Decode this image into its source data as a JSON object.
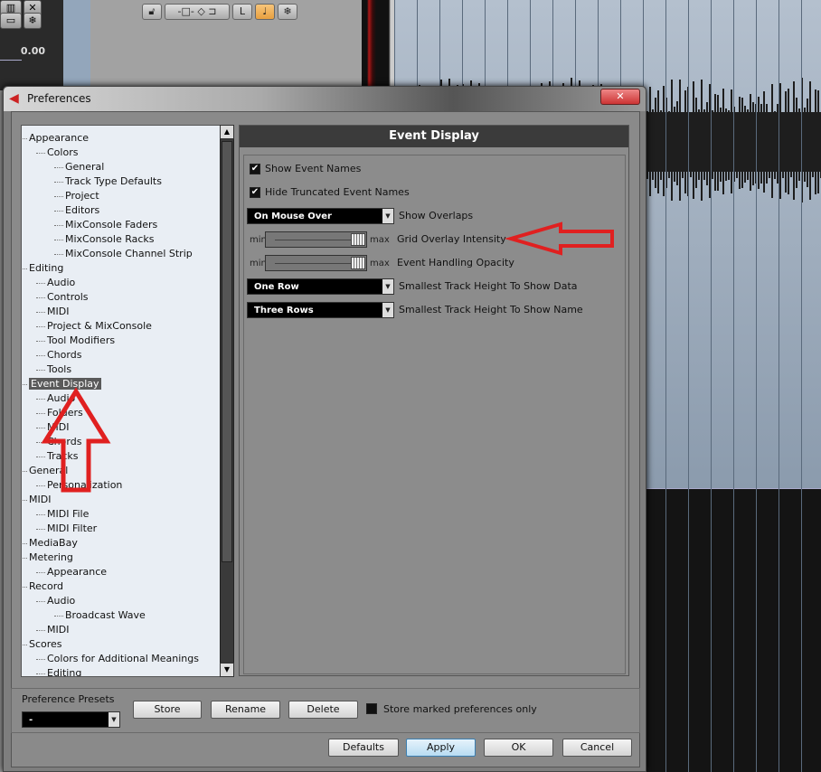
{
  "background": {
    "volume_readout": "0.00",
    "toolbar_icons": [
      "lock-icon",
      "snap-icon",
      "move-icon",
      "glue-icon",
      "corner-icon",
      "note-icon",
      "freeze-icon"
    ]
  },
  "dialog": {
    "title": "Preferences",
    "close_label": "✕",
    "tree": [
      {
        "label": "Appearance",
        "level": 0
      },
      {
        "label": "Colors",
        "level": 1
      },
      {
        "label": "General",
        "level": 2
      },
      {
        "label": "Track Type Defaults",
        "level": 2
      },
      {
        "label": "Project",
        "level": 2
      },
      {
        "label": "Editors",
        "level": 2
      },
      {
        "label": "MixConsole Faders",
        "level": 2
      },
      {
        "label": "MixConsole Racks",
        "level": 2
      },
      {
        "label": "MixConsole Channel Strip",
        "level": 2
      },
      {
        "label": "Editing",
        "level": 0
      },
      {
        "label": "Audio",
        "level": 1
      },
      {
        "label": "Controls",
        "level": 1
      },
      {
        "label": "MIDI",
        "level": 1
      },
      {
        "label": "Project & MixConsole",
        "level": 1
      },
      {
        "label": "Tool Modifiers",
        "level": 1
      },
      {
        "label": "Chords",
        "level": 1
      },
      {
        "label": "Tools",
        "level": 1
      },
      {
        "label": "Event Display",
        "level": 0,
        "selected": true
      },
      {
        "label": "Audio",
        "level": 1
      },
      {
        "label": "Folders",
        "level": 1
      },
      {
        "label": "MIDI",
        "level": 1
      },
      {
        "label": "Chords",
        "level": 1
      },
      {
        "label": "Tracks",
        "level": 1
      },
      {
        "label": "General",
        "level": 0
      },
      {
        "label": "Personalization",
        "level": 1
      },
      {
        "label": "MIDI",
        "level": 0
      },
      {
        "label": "MIDI File",
        "level": 1
      },
      {
        "label": "MIDI Filter",
        "level": 1
      },
      {
        "label": "MediaBay",
        "level": 0
      },
      {
        "label": "Metering",
        "level": 0
      },
      {
        "label": "Appearance",
        "level": 1
      },
      {
        "label": "Record",
        "level": 0
      },
      {
        "label": "Audio",
        "level": 1
      },
      {
        "label": "Broadcast Wave",
        "level": 2
      },
      {
        "label": "MIDI",
        "level": 1
      },
      {
        "label": "Scores",
        "level": 0
      },
      {
        "label": "Colors for Additional Meanings",
        "level": 1
      },
      {
        "label": "Editing",
        "level": 1
      }
    ],
    "panel": {
      "title": "Event Display",
      "show_event_names": {
        "label": "Show Event Names",
        "checked": true
      },
      "hide_truncated": {
        "label": "Hide Truncated Event Names",
        "checked": true
      },
      "show_overlaps": {
        "label": "Show Overlaps",
        "value": "On Mouse Over"
      },
      "grid_overlay": {
        "label": "Grid Overlay Intensity",
        "min": "min",
        "max": "max",
        "value_percent": 100
      },
      "event_handling": {
        "label": "Event Handling Opacity",
        "min": "min",
        "max": "max",
        "value_percent": 100
      },
      "track_height_data": {
        "label": "Smallest Track Height To Show Data",
        "value": "One Row"
      },
      "track_height_name": {
        "label": "Smallest Track Height To Show Name",
        "value": "Three Rows"
      }
    },
    "presets": {
      "label": "Preference Presets",
      "value": "-",
      "store": "Store",
      "rename": "Rename",
      "delete": "Delete",
      "marked_only": {
        "label": "Store marked preferences only",
        "checked": false
      }
    },
    "buttons": {
      "defaults": "Defaults",
      "apply": "Apply",
      "ok": "OK",
      "cancel": "Cancel"
    },
    "annotation_color": "#e02020"
  }
}
